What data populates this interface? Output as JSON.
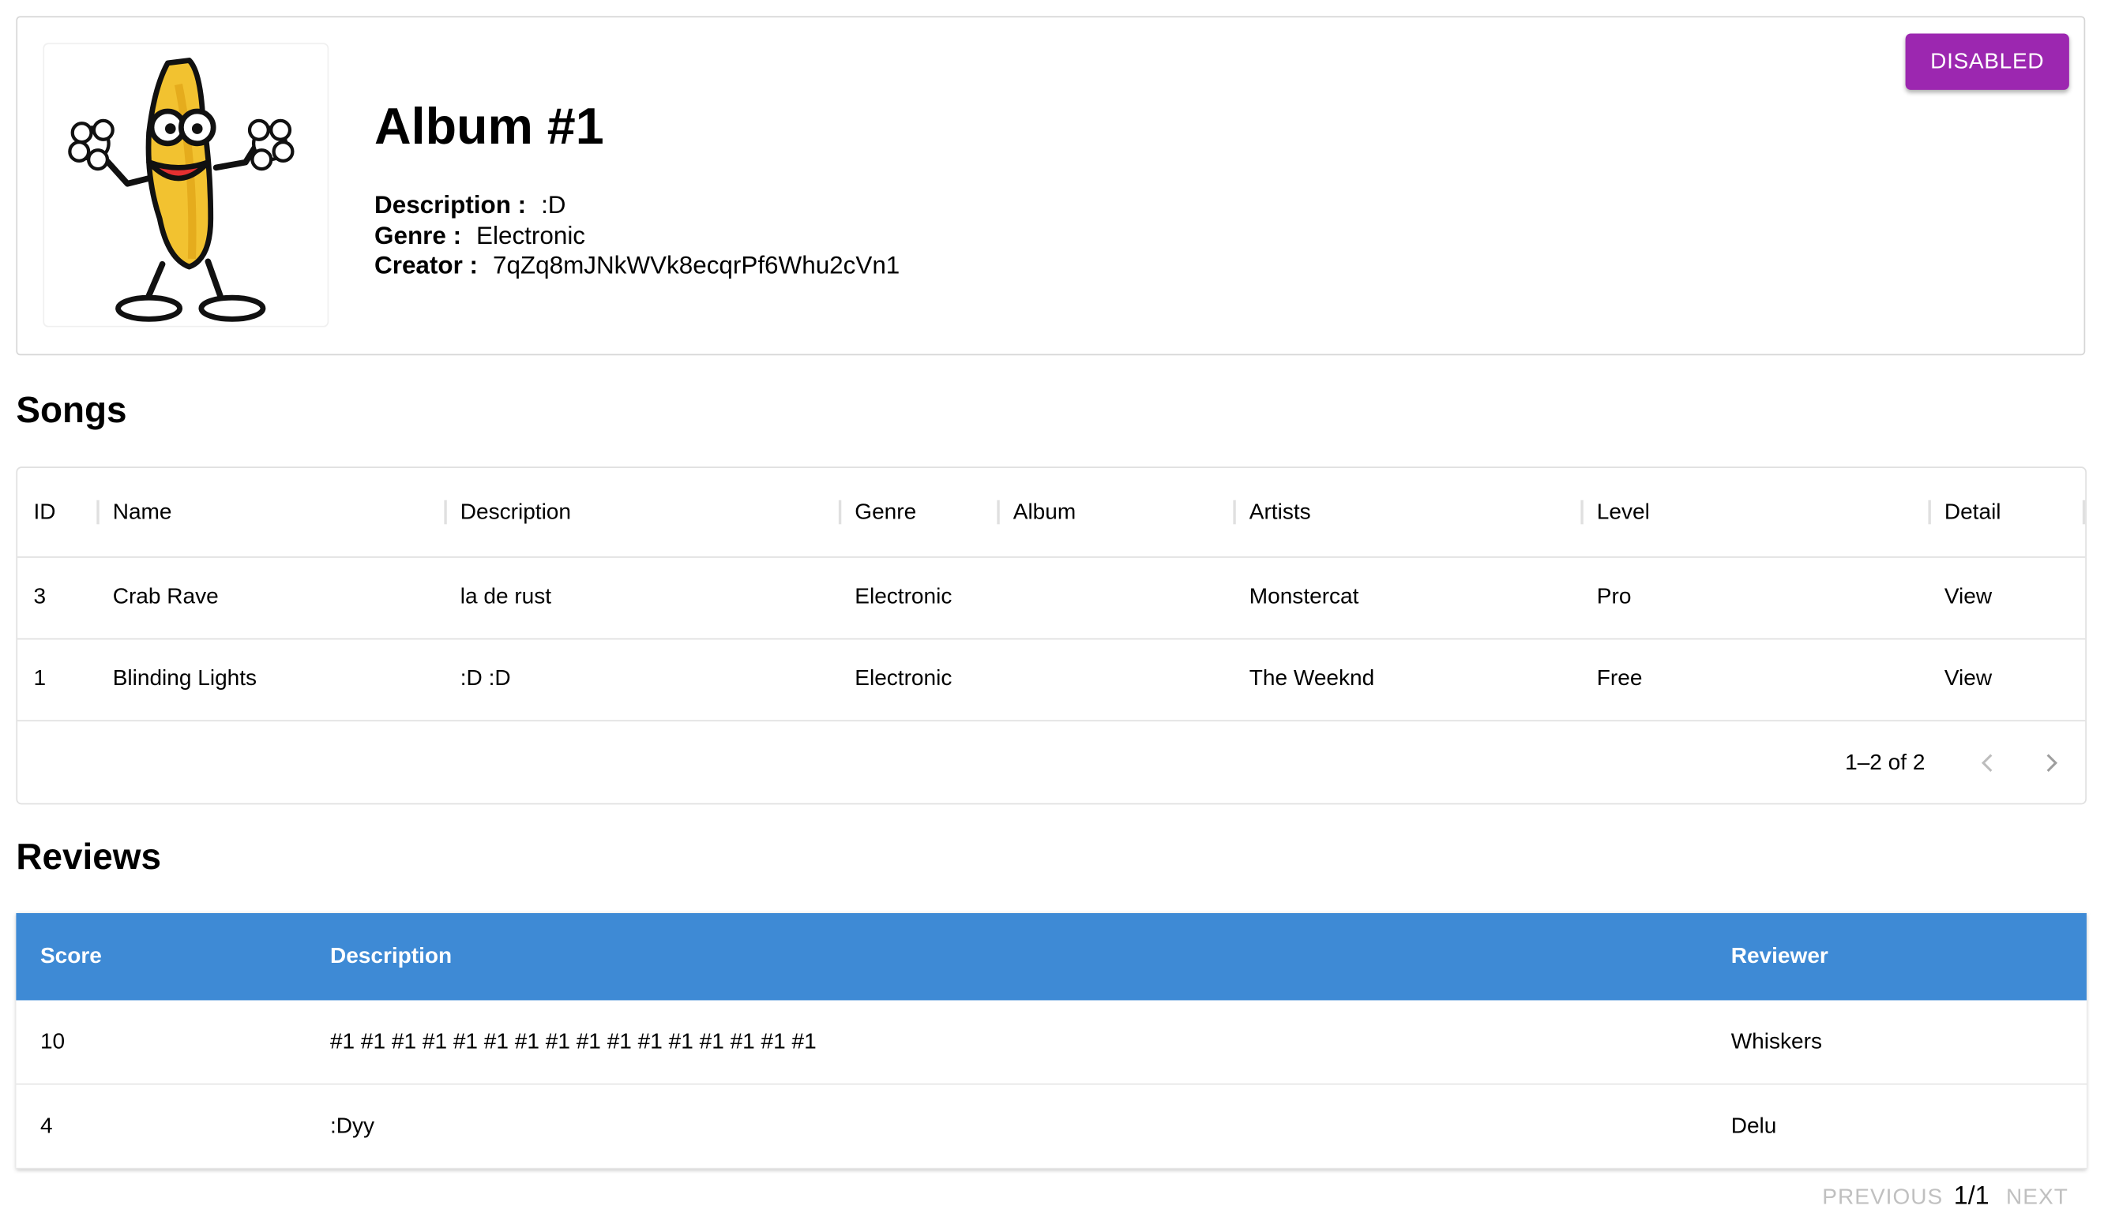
{
  "album": {
    "title": "Album #1",
    "status_button": "DISABLED",
    "cover_icon": "dancing-banana-icon",
    "meta": [
      {
        "key": "Description :",
        "value": ":D"
      },
      {
        "key": "Genre :",
        "value": "Electronic"
      },
      {
        "key": "Creator :",
        "value": "7qZq8mJNkWVk8ecqrPf6Whu2cVn1"
      }
    ]
  },
  "songs": {
    "title": "Songs",
    "columns": [
      "ID",
      "Name",
      "Description",
      "Genre",
      "Album",
      "Artists",
      "Level",
      "Detail"
    ],
    "rows": [
      {
        "id": "3",
        "name": "Crab Rave",
        "description": "la de rust",
        "genre": "Electronic",
        "album": "",
        "artists": "Monstercat",
        "level": "Pro",
        "detail": "View"
      },
      {
        "id": "1",
        "name": "Blinding Lights",
        "description": ":D :D",
        "genre": "Electronic",
        "album": "",
        "artists": "The Weeknd",
        "level": "Free",
        "detail": "View"
      }
    ],
    "pagination": "1–2 of 2"
  },
  "reviews": {
    "title": "Reviews",
    "columns": [
      "Score",
      "Description",
      "Reviewer"
    ],
    "rows": [
      {
        "score": "10",
        "description": "#1 #1 #1 #1 #1 #1 #1 #1 #1 #1 #1 #1 #1 #1 #1 #1",
        "reviewer": "Whiskers"
      },
      {
        "score": "4",
        "description": ":Dyy",
        "reviewer": "Delu"
      }
    ],
    "pager": {
      "previous": "PREVIOUS",
      "page": "1/1",
      "next": "NEXT"
    }
  },
  "colors": {
    "accent_purple": "#9c27b0",
    "table_header_blue": "#3e8ad5",
    "disabled_text": "#c0c0c0"
  }
}
